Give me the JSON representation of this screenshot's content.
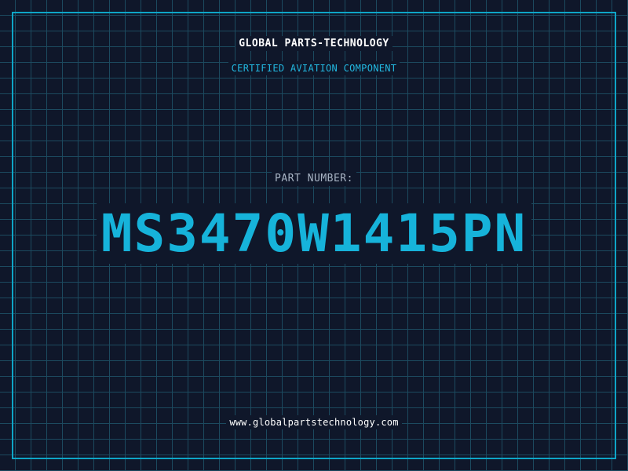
{
  "header": {
    "company_name": "GLOBAL PARTS-TECHNOLOGY",
    "certification": "CERTIFIED AVIATION COMPONENT"
  },
  "part": {
    "label": "PART NUMBER:",
    "number": "MS3470W1415PN"
  },
  "footer": {
    "website": "www.globalpartstechnology.com"
  },
  "colors": {
    "background": "#0f172a",
    "grid": "#1c4a5f",
    "accent": "#16b3da",
    "frame": "#0ea5c6",
    "label": "#a8b4c4",
    "text": "#ffffff"
  }
}
